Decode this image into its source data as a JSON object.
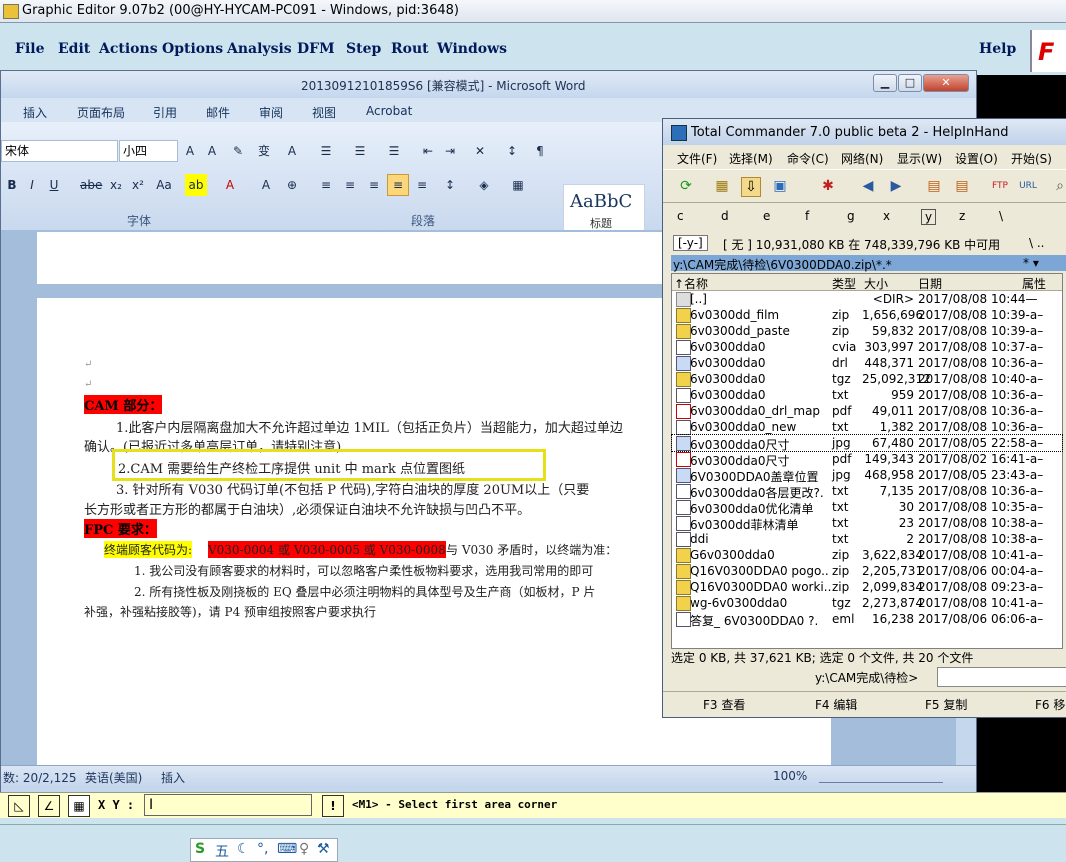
{
  "genesis": {
    "title": "Graphic Editor 9.07b2 (00@HY-HYCAM-PC091 - Windows, pid:3648)",
    "menu": [
      "File",
      "Edit",
      "Actions",
      "Options",
      "Analysis",
      "DFM",
      "Step",
      "Rout",
      "Windows"
    ],
    "help": "Help",
    "logo": "F",
    "xy_label": "X Y :",
    "xy_value": "I",
    "prompt": "<M1> - Select first area corner",
    "ime": [
      "五",
      "☾",
      "°,",
      "⌨",
      "♀",
      "⚒"
    ]
  },
  "word": {
    "title": "20130912101859S6 [兼容模式] - Microsoft Word",
    "tabs": [
      "插入",
      "页面布局",
      "引用",
      "邮件",
      "审阅",
      "视图",
      "Acrobat"
    ],
    "font_name": "宋体",
    "font_size": "小四",
    "style_preview": "AaBbC",
    "style_name": "标题",
    "group_font": "字体",
    "group_para": "段落",
    "doc": {
      "l1": "CAM 部分：",
      "l2": "1.此客户内层隔离盘加大不允许超过单边 1MIL（包括正负片）当超能力，加大超过单边",
      "l3": "确认。(已报近过多单高层订单，请特别注意)",
      "l4": "2.CAM 需要给生产终检工序提供 unit 中 mark 点位置图纸",
      "l5": "3. 针对所有 V030 代码订单(不包括 P 代码),字符白油块的厚度 20UM以上（只要",
      "l6": "长方形或者正方形的都属于白油块）,必须保证白油块不允许缺损与凹凸不平。",
      "l7": "FPC 要求：",
      "l8a": "终端顾客代码为:",
      "l8b": "V030-0004 或 V030-0005 或 V030-0008",
      "l8c": "与 V030 矛盾时，以终端为准：",
      "l9": "1. 我公司没有顾客要求的材料时，可以忽略客户柔性板物料要求，选用我司常用的即可",
      "l10": "2. 所有挠性板及刚挠板的 EQ 叠层中必须注明物料的具体型号及生产商（如板材，P 片",
      "l11": "补强，补强粘接胶等)，请 P4 预审组按照客户要求执行"
    },
    "status": {
      "words": "数: 20/2,125",
      "lang": "英语(美国)",
      "mode": "插入",
      "zoom": "100%"
    }
  },
  "tc": {
    "title": "Total Commander 7.0 public beta 2 - HelpInHand",
    "menu": [
      "文件(F)",
      "选择(M)",
      "命令(C)",
      "网络(N)",
      "显示(W)",
      "设置(O)",
      "开始(S)"
    ],
    "drives": [
      "c",
      "d",
      "e",
      "f",
      "g",
      "x",
      "y",
      "z",
      "\\"
    ],
    "drive_sel": "[-y-]",
    "info": "[ 无 ]  10,931,080 KB 在 748,339,796 KB 中可用",
    "info_right": "\\  ..",
    "path": "y:\\CAM完成\\待检\\6V0300DDA0.zip\\*.*",
    "path_right": "*  ▾",
    "headers": [
      "↑名称",
      "类型",
      "大小",
      "日期",
      "属性"
    ],
    "files": [
      {
        "n": "[..]",
        "t": "",
        "s": "<DIR>",
        "d": "2017/08/08 10:44—",
        "i": "up"
      },
      {
        "n": "6v0300dd_film",
        "t": "zip",
        "s": "1,656,696",
        "d": "2017/08/08 10:39-a–",
        "i": "y"
      },
      {
        "n": "6v0300dd_paste",
        "t": "zip",
        "s": "59,832",
        "d": "2017/08/08 10:39-a–",
        "i": "y"
      },
      {
        "n": "6v0300dda0",
        "t": "cvia",
        "s": "303,997",
        "d": "2017/08/08 10:37-a–",
        "i": "w"
      },
      {
        "n": "6v0300dda0",
        "t": "drl",
        "s": "448,371",
        "d": "2017/08/08 10:36-a–",
        "i": "b"
      },
      {
        "n": "6v0300dda0",
        "t": "tgz",
        "s": "25,092,312",
        "d": "2017/08/08 10:40-a–",
        "i": "y"
      },
      {
        "n": "6v0300dda0",
        "t": "txt",
        "s": "959",
        "d": "2017/08/08 10:36-a–",
        "i": "w"
      },
      {
        "n": "6v0300dda0_drl_map",
        "t": "pdf",
        "s": "49,011",
        "d": "2017/08/08 10:36-a–",
        "i": "r"
      },
      {
        "n": "6v0300dda0_new",
        "t": "txt",
        "s": "1,382",
        "d": "2017/08/08 10:36-a–",
        "i": "w"
      },
      {
        "n": "6v0300dda0尺寸",
        "t": "jpg",
        "s": "67,480",
        "d": "2017/08/05 22:58-a–",
        "i": "b"
      },
      {
        "n": "6v0300dda0尺寸",
        "t": "pdf",
        "s": "149,343",
        "d": "2017/08/02 16:41-a–",
        "i": "r"
      },
      {
        "n": "6V0300DDA0盖章位置",
        "t": "jpg",
        "s": "468,958",
        "d": "2017/08/05 23:43-a–",
        "i": "b"
      },
      {
        "n": "6v0300dda0各层更改?.",
        "t": "txt",
        "s": "7,135",
        "d": "2017/08/08 10:36-a–",
        "i": "w"
      },
      {
        "n": "6v0300dda0优化清单",
        "t": "txt",
        "s": "30",
        "d": "2017/08/08 10:35-a–",
        "i": "w"
      },
      {
        "n": "6v0300dd菲林清单",
        "t": "txt",
        "s": "23",
        "d": "2017/08/08 10:38-a–",
        "i": "w"
      },
      {
        "n": "ddi",
        "t": "txt",
        "s": "2",
        "d": "2017/08/08 10:38-a–",
        "i": "w"
      },
      {
        "n": "G6v0300dda0",
        "t": "zip",
        "s": "3,622,834",
        "d": "2017/08/08 10:41-a–",
        "i": "y"
      },
      {
        "n": "Q16V0300DDA0 pogo..",
        "t": "zip",
        "s": "2,205,731",
        "d": "2017/08/06 00:04-a–",
        "i": "y"
      },
      {
        "n": "Q16V0300DDA0 worki..",
        "t": "zip",
        "s": "2,099,834",
        "d": "2017/08/08 09:23-a–",
        "i": "y"
      },
      {
        "n": "wg-6v0300dda0",
        "t": "tgz",
        "s": "2,273,874",
        "d": "2017/08/08 10:41-a–",
        "i": "y"
      },
      {
        "n": "答复_ 6V0300DDA0 ?.",
        "t": "eml",
        "s": "16,238",
        "d": "2017/08/06 06:06-a–",
        "i": "w"
      }
    ],
    "selection": "选定 0 KB, 共 37,621 KB; 选定 0 个文件, 共 20 个文件",
    "cmd_path": "y:\\CAM完成\\待检>",
    "fkeys": [
      "F3 查看",
      "F4 编辑",
      "F5 复制",
      "F6 移"
    ]
  }
}
